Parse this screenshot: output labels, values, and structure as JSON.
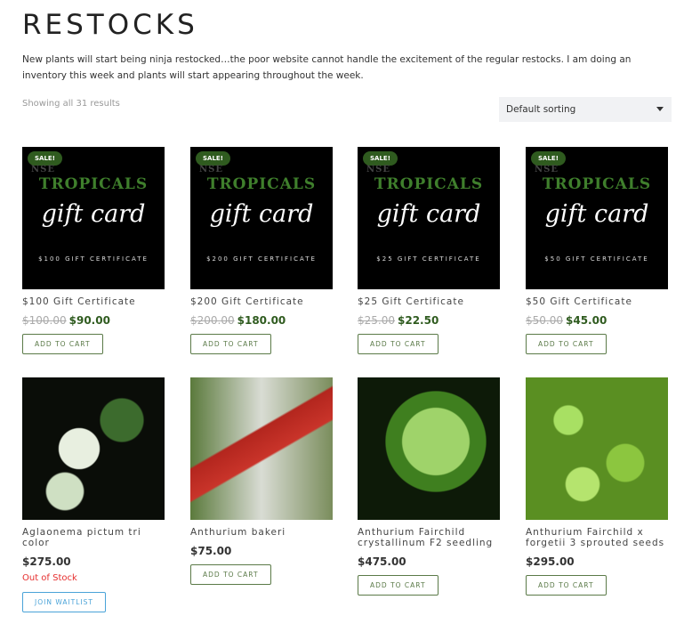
{
  "page": {
    "title": "RESTOCKS",
    "description": "New plants will start being ninja restocked…the poor website cannot handle the excitement of the regular restocks. I am doing an inventory this week and plants will start appearing throughout the week.",
    "result_count": "Showing all 31 results",
    "sorting": "Default sorting"
  },
  "gift_logo": {
    "small": "NSE",
    "big": "TROPICALS",
    "script": "gift card"
  },
  "products": [
    {
      "name": "$100 Gift Certificate",
      "old_price": "$100.00",
      "price": "$90.00",
      "badge": "SALE!",
      "cert": "$100 GIFT CERTIFICATE",
      "button": "ADD TO CART"
    },
    {
      "name": "$200 Gift Certificate",
      "old_price": "$200.00",
      "price": "$180.00",
      "badge": "SALE!",
      "cert": "$200 GIFT CERTIFICATE",
      "button": "ADD TO CART"
    },
    {
      "name": "$25 Gift Certificate",
      "old_price": "$25.00",
      "price": "$22.50",
      "badge": "SALE!",
      "cert": "$25 GIFT CERTIFICATE",
      "button": "ADD TO CART"
    },
    {
      "name": "$50 Gift Certificate",
      "old_price": "$50.00",
      "price": "$45.00",
      "badge": "SALE!",
      "cert": "$50 GIFT CERTIFICATE",
      "button": "ADD TO CART"
    },
    {
      "name": "Aglaonema pictum tri color",
      "price": "$275.00",
      "stock": "Out of Stock",
      "button": "JOIN WAITLIST"
    },
    {
      "name": "Anthurium bakeri",
      "price": "$75.00",
      "button": "ADD TO CART"
    },
    {
      "name": "Anthurium Fairchild crystallinum F2 seedling",
      "price": "$475.00",
      "button": "ADD TO CART"
    },
    {
      "name": "Anthurium Fairchild x forgetii 3 sprouted seeds",
      "price": "$295.00",
      "button": "ADD TO CART"
    }
  ]
}
